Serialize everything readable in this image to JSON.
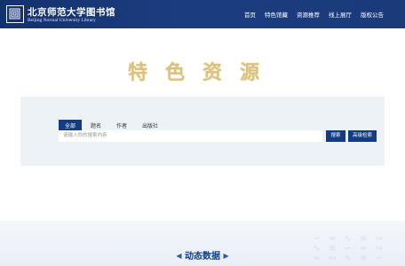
{
  "header": {
    "brand_cn": "北京师范大学图书馆",
    "brand_en": "Beijing Normal University Library",
    "nav": [
      "首页",
      "特色馆藏",
      "资源推荐",
      "线上展厅",
      "版权公告"
    ]
  },
  "hero": {
    "title": "特色资源"
  },
  "search": {
    "tabs": [
      "全部",
      "题名",
      "作者",
      "出版社"
    ],
    "active_tab": "全部",
    "placeholder": "请输入你的搜索内容",
    "search_label": "搜索",
    "advanced_label": "高级检索"
  },
  "section": {
    "title": "动态数据",
    "left_arrow": "◀",
    "right_arrow": "▶"
  },
  "colors": {
    "header_bg": "#1a3a7a",
    "accent": "#123c86",
    "calligraphy": "#d9c27f",
    "panel_bg": "#edf2f7"
  }
}
